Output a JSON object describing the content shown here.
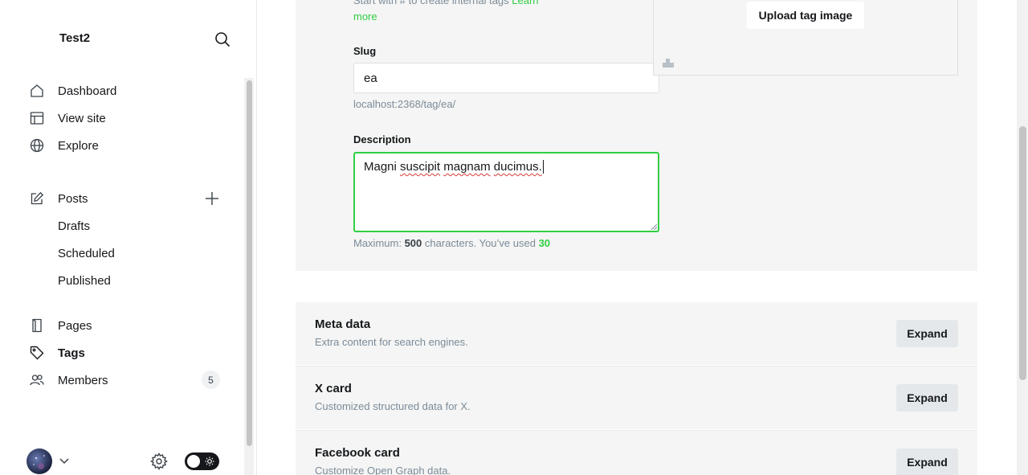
{
  "sidebar": {
    "site_title": "Test2",
    "nav": [
      {
        "label": "Dashboard",
        "icon": "home-icon"
      },
      {
        "label": "View site",
        "icon": "layout-icon"
      },
      {
        "label": "Explore",
        "icon": "globe-icon"
      }
    ],
    "posts": {
      "label": "Posts",
      "icon": "edit-icon"
    },
    "post_subs": [
      "Drafts",
      "Scheduled",
      "Published"
    ],
    "pages": {
      "label": "Pages",
      "icon": "pages-icon"
    },
    "tags": {
      "label": "Tags",
      "icon": "tag-icon"
    },
    "members": {
      "label": "Members",
      "icon": "members-icon",
      "count": "5"
    }
  },
  "form": {
    "hint_top": "Start with # to create internal tags",
    "hint_link": "Learn more",
    "slug_label": "Slug",
    "slug_value": "ea",
    "slug_url": "localhost:2368/tag/ea/",
    "description_label": "Description",
    "description_words": [
      "Magni",
      "suscipit",
      "magnam",
      "ducimus."
    ],
    "char_hint_prefix": "Maximum:",
    "char_max": "500",
    "char_hint_mid": "characters. You’ve used",
    "char_used": "30",
    "upload_label": "Upload tag image"
  },
  "sections": [
    {
      "title": "Meta data",
      "description": "Extra content for search engines.",
      "button": "Expand"
    },
    {
      "title": "X card",
      "description": "Customized structured data for X.",
      "button": "Expand"
    },
    {
      "title": "Facebook card",
      "description": "Customize Open Graph data.",
      "button": "Expand"
    }
  ],
  "colors": {
    "accent": "#30cf43",
    "text": "#15171a",
    "muted": "#7c8b9a",
    "panel": "#f4f5f4"
  }
}
